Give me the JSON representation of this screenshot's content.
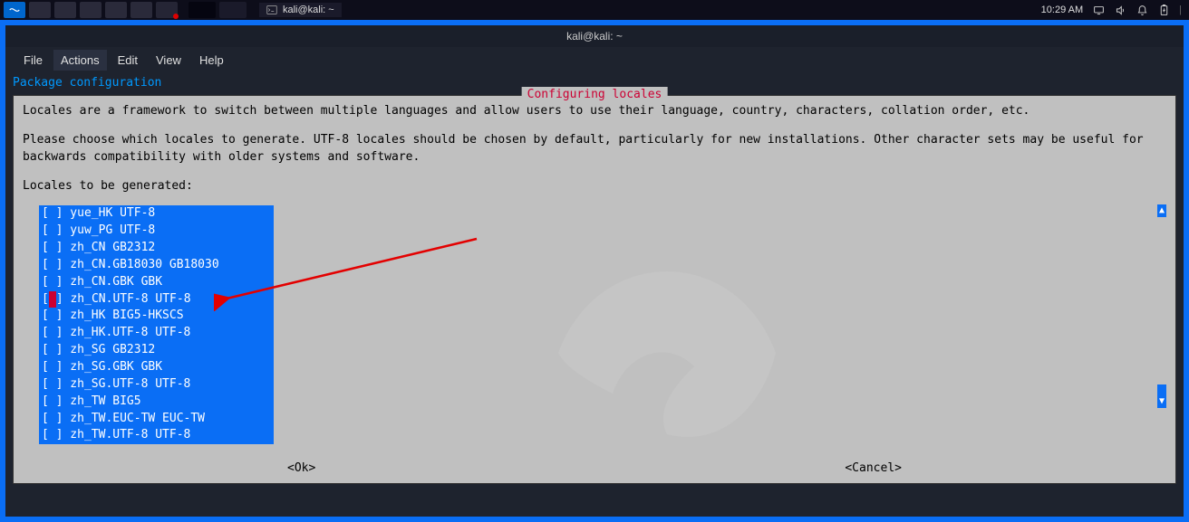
{
  "panel": {
    "taskbar_title": "kali@kali: ~",
    "clock": "10:29 AM"
  },
  "window": {
    "title": "kali@kali: ~"
  },
  "menu": {
    "file": "File",
    "actions": "Actions",
    "edit": "Edit",
    "view": "View",
    "help": "Help"
  },
  "terminal": {
    "header": "Package configuration",
    "dialog_title": "Configuring locales",
    "text_line1": "Locales are a framework to switch between multiple languages and allow users to use their language, country, characters, collation order, etc.",
    "text_line2": "Please choose which locales to generate. UTF-8 locales should be chosen by default, particularly for new installations. Other character sets may be useful for backwards compatibility with older systems and software.",
    "text_line3": "Locales to be generated:",
    "ok": "<Ok>",
    "cancel": "<Cancel>"
  },
  "locales": [
    {
      "checked": false,
      "cursor": false,
      "label": "yue_HK UTF-8"
    },
    {
      "checked": false,
      "cursor": false,
      "label": "yuw_PG UTF-8"
    },
    {
      "checked": false,
      "cursor": false,
      "label": "zh_CN GB2312"
    },
    {
      "checked": false,
      "cursor": false,
      "label": "zh_CN.GB18030 GB18030"
    },
    {
      "checked": false,
      "cursor": false,
      "label": "zh_CN.GBK GBK"
    },
    {
      "checked": false,
      "cursor": true,
      "label": "zh_CN.UTF-8 UTF-8"
    },
    {
      "checked": false,
      "cursor": false,
      "label": "zh_HK BIG5-HKSCS"
    },
    {
      "checked": false,
      "cursor": false,
      "label": "zh_HK.UTF-8 UTF-8"
    },
    {
      "checked": false,
      "cursor": false,
      "label": "zh_SG GB2312"
    },
    {
      "checked": false,
      "cursor": false,
      "label": "zh_SG.GBK GBK"
    },
    {
      "checked": false,
      "cursor": false,
      "label": "zh_SG.UTF-8 UTF-8"
    },
    {
      "checked": false,
      "cursor": false,
      "label": "zh_TW BIG5"
    },
    {
      "checked": false,
      "cursor": false,
      "label": "zh_TW.EUC-TW EUC-TW"
    },
    {
      "checked": false,
      "cursor": false,
      "label": "zh_TW.UTF-8 UTF-8"
    }
  ]
}
